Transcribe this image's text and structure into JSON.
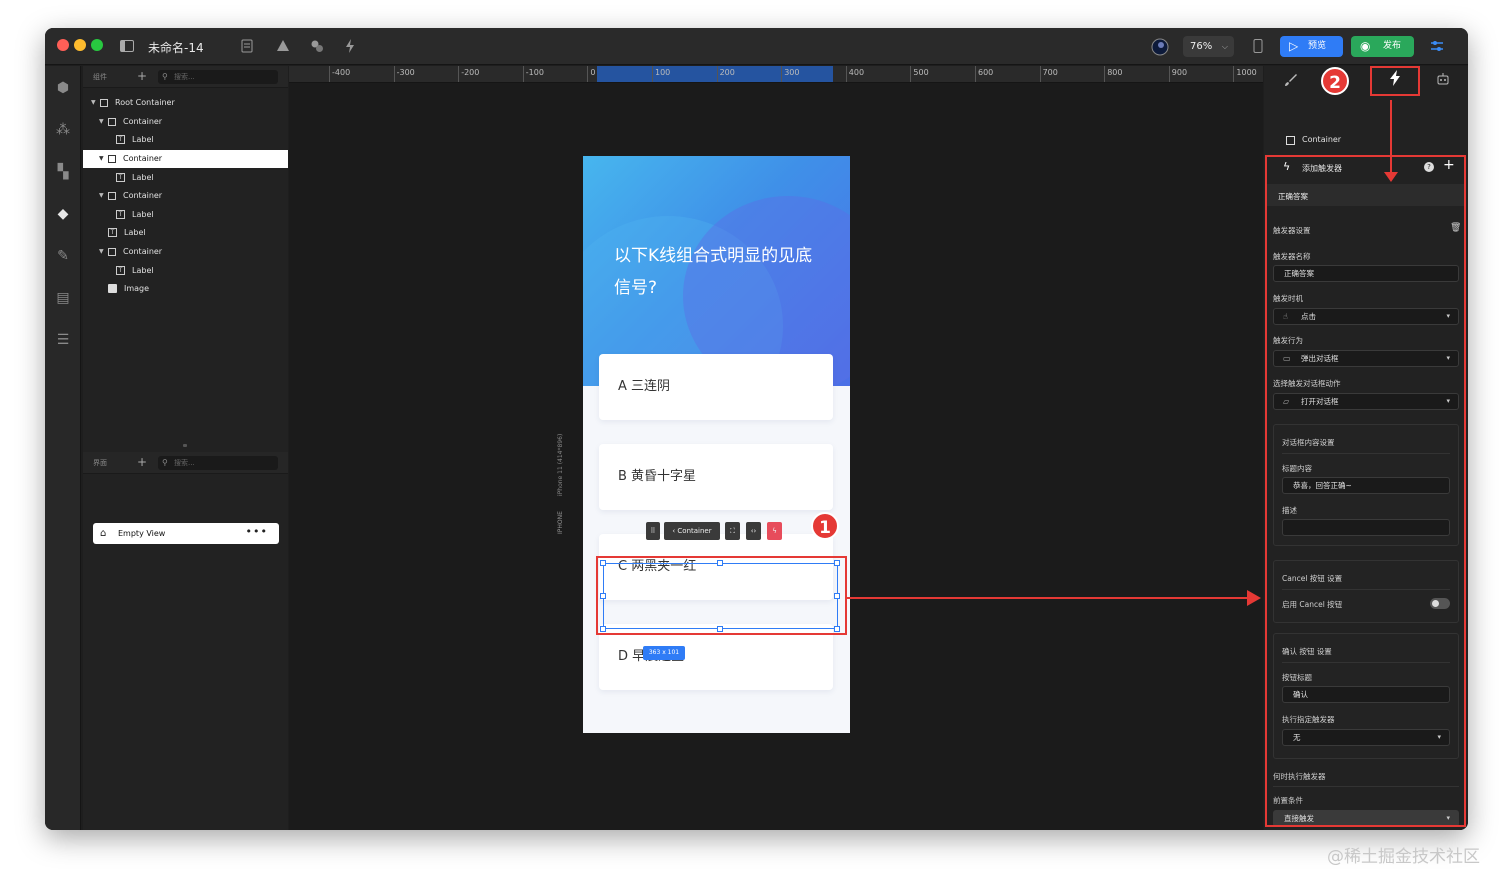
{
  "app": {
    "doc_title": "未命名-14",
    "zoom": "76%",
    "preview_label": "预览",
    "publish_label": "发布"
  },
  "left_panel": {
    "components_tab": "组件",
    "search_placeholder": "搜索...",
    "tree": [
      {
        "label": "Root Container",
        "kind": "container"
      },
      {
        "label": "Container",
        "kind": "container"
      },
      {
        "label": "Label",
        "kind": "label"
      },
      {
        "label": "Container",
        "kind": "container"
      },
      {
        "label": "Label",
        "kind": "label"
      },
      {
        "label": "Container",
        "kind": "container"
      },
      {
        "label": "Label",
        "kind": "label"
      },
      {
        "label": "Label",
        "kind": "label"
      },
      {
        "label": "Container",
        "kind": "container"
      },
      {
        "label": "Label",
        "kind": "label"
      },
      {
        "label": "Image",
        "kind": "image"
      }
    ],
    "views_tab": "界面",
    "views_search_placeholder": "搜索...",
    "view_item": "Empty View",
    "view_more": "•••"
  },
  "canvas": {
    "ruler_ticks": [
      "-400",
      "-300",
      "-200",
      "-100",
      "0",
      "100",
      "200",
      "300",
      "400",
      "500",
      "600",
      "700",
      "800",
      "900",
      "1000"
    ],
    "device_name": "iPhone 11 (414*896)",
    "device_type": "IPHONE",
    "question": "以下K线组合式明显的见底信号?",
    "options": [
      "A  三连阴",
      "B  黄昏十字星",
      "C  两黑夹一红",
      "D  早晨之星"
    ],
    "selection_size": "363 x 101",
    "context_container_label": "Container",
    "callout_1": "1",
    "callout_2": "2"
  },
  "right_panel": {
    "selected_component": "Container",
    "add_trigger": "添加触发器",
    "trigger_name_header": "正确答案",
    "trigger_settings": "触发器设置",
    "name_label": "触发器名称",
    "name_value": "正确答案",
    "timing_label": "触发时机",
    "timing_value": "点击",
    "action_label": "触发行为",
    "action_value": "弹出对话框",
    "dialog_action_label": "选择触发对话框动作",
    "dialog_action_value": "打开对话框",
    "dialog_content_settings": "对话框内容设置",
    "title_content_label": "标题内容",
    "title_content_value": "恭喜，回答正确~",
    "desc_label": "描述",
    "desc_value": "",
    "cancel_settings": "Cancel 按钮 设置",
    "enable_cancel": "启用 Cancel 按钮",
    "cancel_enabled": false,
    "confirm_settings": "确认 按钮 设置",
    "button_title_label": "按钮标题",
    "button_title_value": "确认",
    "exec_trigger_label": "执行指定触发器",
    "exec_trigger_value": "无",
    "when_exec_label": "何时执行触发器",
    "precondition_label": "前置条件",
    "precondition_value": "直接触发"
  },
  "watermark": "@稀土掘金技术社区",
  "colors": {
    "accent_blue": "#2f7cf6",
    "publish_green": "#2aa85b",
    "annotation_red": "#e53935"
  }
}
